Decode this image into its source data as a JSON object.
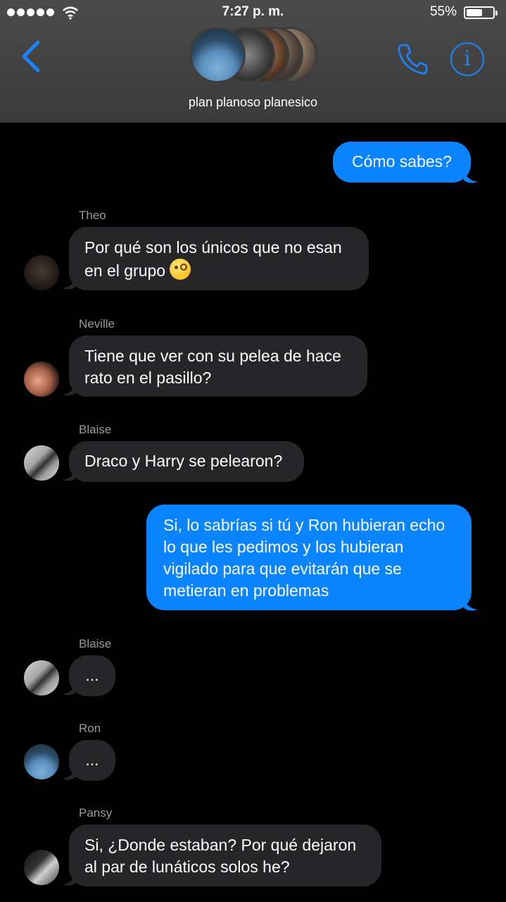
{
  "status_bar": {
    "time": "7:27 p. m.",
    "battery_percent": "55%",
    "battery_level": 0.55,
    "signal_bars": 5
  },
  "header": {
    "group_name": "plan planoso planesico",
    "back_icon": "chevron-left-icon",
    "call_icon": "phone-icon",
    "info_icon": "info-icon",
    "info_glyph": "i",
    "accent_color": "#1a84ff"
  },
  "messages": [
    {
      "direction": "outgoing",
      "text": "Cómo sabes?"
    },
    {
      "direction": "incoming",
      "sender": "Theo",
      "text": "Por qué son los únicos que no esan en el grupo",
      "emoji": "face-with-monocle"
    },
    {
      "direction": "incoming",
      "sender": "Neville",
      "text": "Tiene que ver con su pelea de hace rato en el pasillo?"
    },
    {
      "direction": "incoming",
      "sender": "Blaise",
      "text": "Draco y Harry se pelearon?"
    },
    {
      "direction": "outgoing",
      "text": "Si, lo sabrías si tú y Ron hubieran echo lo que les pedimos y los hubieran vigilado para que evitarán que se metieran en problemas"
    },
    {
      "direction": "incoming",
      "sender": "Blaise",
      "text": "..."
    },
    {
      "direction": "incoming",
      "sender": "Ron",
      "text": "..."
    },
    {
      "direction": "incoming",
      "sender": "Pansy",
      "text": "Si, ¿Donde estaban? Por qué dejaron al par de lunáticos solos he?"
    }
  ],
  "colors": {
    "outgoing_bubble": "#0a84ff",
    "incoming_bubble": "#262628",
    "background": "#000000",
    "header": "#444444"
  }
}
